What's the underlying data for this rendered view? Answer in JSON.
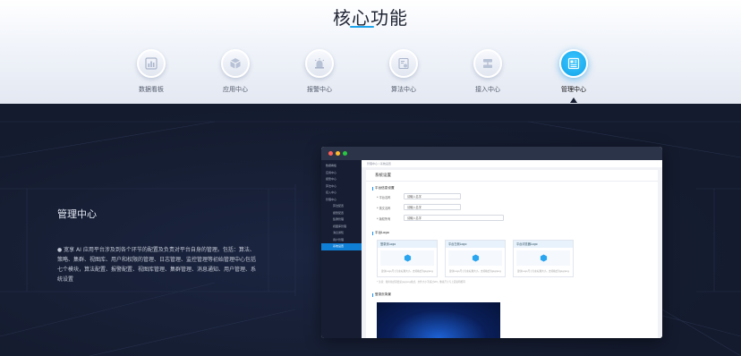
{
  "header": {
    "title": "核心功能",
    "accent_color": "#1ea4ec"
  },
  "tabs": [
    {
      "label": "数据看板",
      "icon": "bar-chart-icon",
      "active": false
    },
    {
      "label": "应用中心",
      "icon": "cube-icon",
      "active": false
    },
    {
      "label": "报警中心",
      "icon": "alarm-light-icon",
      "active": false
    },
    {
      "label": "算法中心",
      "icon": "algorithm-icon",
      "active": false
    },
    {
      "label": "接入中心",
      "icon": "access-icon",
      "active": false
    },
    {
      "label": "管理中心",
      "icon": "management-icon",
      "active": true
    }
  ],
  "section": {
    "title": "管理中心",
    "description": "● 宽享 AI 应用平台涉及到各个环节的配置及负责对平台自身的管理。包括：算法、策略、集群、视图库、用户和权限的管理、日志管理、监控管理等初始管理中心包括七个模块，算法配置、报警配置、视图库管理、集群管理、消息通知、用户管理、系统设置"
  },
  "app_window": {
    "sidebar": [
      {
        "label": "数据看板",
        "sub": false,
        "selected": false
      },
      {
        "label": "应用中心",
        "sub": false,
        "selected": false
      },
      {
        "label": "报警中心",
        "sub": false,
        "selected": false
      },
      {
        "label": "算法中心",
        "sub": false,
        "selected": false
      },
      {
        "label": "接入中心",
        "sub": false,
        "selected": false
      },
      {
        "label": "管理中心",
        "sub": false,
        "selected": false
      },
      {
        "label": "算法配置",
        "sub": true,
        "selected": false
      },
      {
        "label": "报警配置",
        "sub": true,
        "selected": false
      },
      {
        "label": "集群管理",
        "sub": true,
        "selected": false
      },
      {
        "label": "视图库管理",
        "sub": true,
        "selected": false
      },
      {
        "label": "消息通知",
        "sub": true,
        "selected": false
      },
      {
        "label": "用户管理",
        "sub": true,
        "selected": false
      },
      {
        "label": "系统设置",
        "sub": true,
        "selected": true
      }
    ],
    "breadcrumb": "管理中心  /  系统设置",
    "page_title": "系统设置",
    "basic_section": "平台信息设置",
    "fields": [
      {
        "label": "* 平台名称",
        "value": "请输入名字"
      },
      {
        "label": "* 英文名称",
        "value": "请输入名字"
      },
      {
        "label": "* 版权所有",
        "value": "请输入名字"
      }
    ],
    "logo_section": "平台Logo",
    "cards": [
      {
        "title": "登录页Logo",
        "tip": "建议Logo尺寸为主标题大小，支持格式为jpg/png"
      },
      {
        "title": "平台左侧Logo",
        "tip": "建议Logo尺寸为主标题大小，支持格式为jpg/png"
      },
      {
        "title": "平台浏览器Logo",
        "tip": "建议Logo尺寸为主标题大小，支持格式为jpg/png"
      }
    ],
    "note": "* 注意：图片格式需要是jpg/png格式，文件大小不超过2M，像素尺寸与上面说明相同",
    "bg_section": "登录页背景"
  }
}
